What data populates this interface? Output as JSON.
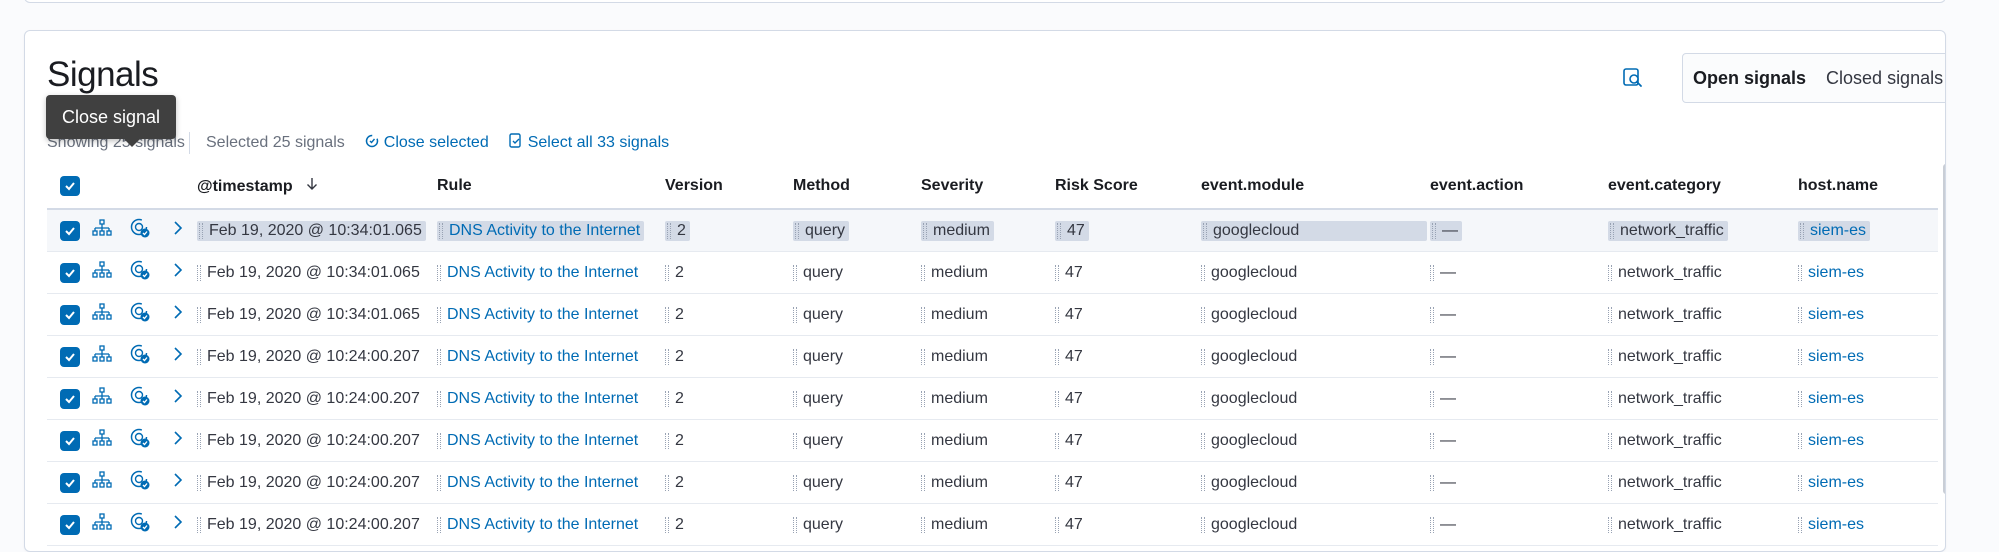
{
  "page": {
    "title": "Signals",
    "toggle": {
      "open_label": "Open signals",
      "closed_label": "Closed signals"
    },
    "inspect_icon": "inspect-icon"
  },
  "utility_bar": {
    "showing_label": "Showing 25 signals",
    "selected_label": "Selected 25 signals",
    "close_selected_label": "Close selected",
    "select_all_label": "Select all 33 signals"
  },
  "tooltip": {
    "text": "Close signal"
  },
  "columns": {
    "timestamp": "@timestamp",
    "rule": "Rule",
    "version": "Version",
    "method": "Method",
    "severity": "Severity",
    "risk_score": "Risk Score",
    "event_module": "event.module",
    "event_action": "event.action",
    "event_category": "event.category",
    "host_name": "host.name"
  },
  "rows": [
    {
      "timestamp": "Feb 19, 2020 @ 10:34:01.065",
      "rule": "DNS Activity to the Internet",
      "version": "2",
      "method": "query",
      "severity": "medium",
      "risk_score": "47",
      "event_module": "googlecloud",
      "event_action": "—",
      "event_category": "network_traffic",
      "host_name": "siem-es"
    },
    {
      "timestamp": "Feb 19, 2020 @ 10:34:01.065",
      "rule": "DNS Activity to the Internet",
      "version": "2",
      "method": "query",
      "severity": "medium",
      "risk_score": "47",
      "event_module": "googlecloud",
      "event_action": "—",
      "event_category": "network_traffic",
      "host_name": "siem-es"
    },
    {
      "timestamp": "Feb 19, 2020 @ 10:34:01.065",
      "rule": "DNS Activity to the Internet",
      "version": "2",
      "method": "query",
      "severity": "medium",
      "risk_score": "47",
      "event_module": "googlecloud",
      "event_action": "—",
      "event_category": "network_traffic",
      "host_name": "siem-es"
    },
    {
      "timestamp": "Feb 19, 2020 @ 10:24:00.207",
      "rule": "DNS Activity to the Internet",
      "version": "2",
      "method": "query",
      "severity": "medium",
      "risk_score": "47",
      "event_module": "googlecloud",
      "event_action": "—",
      "event_category": "network_traffic",
      "host_name": "siem-es"
    },
    {
      "timestamp": "Feb 19, 2020 @ 10:24:00.207",
      "rule": "DNS Activity to the Internet",
      "version": "2",
      "method": "query",
      "severity": "medium",
      "risk_score": "47",
      "event_module": "googlecloud",
      "event_action": "—",
      "event_category": "network_traffic",
      "host_name": "siem-es"
    },
    {
      "timestamp": "Feb 19, 2020 @ 10:24:00.207",
      "rule": "DNS Activity to the Internet",
      "version": "2",
      "method": "query",
      "severity": "medium",
      "risk_score": "47",
      "event_module": "googlecloud",
      "event_action": "—",
      "event_category": "network_traffic",
      "host_name": "siem-es"
    },
    {
      "timestamp": "Feb 19, 2020 @ 10:24:00.207",
      "rule": "DNS Activity to the Internet",
      "version": "2",
      "method": "query",
      "severity": "medium",
      "risk_score": "47",
      "event_module": "googlecloud",
      "event_action": "—",
      "event_category": "network_traffic",
      "host_name": "siem-es"
    },
    {
      "timestamp": "Feb 19, 2020 @ 10:24:00.207",
      "rule": "DNS Activity to the Internet",
      "version": "2",
      "method": "query",
      "severity": "medium",
      "risk_score": "47",
      "event_module": "googlecloud",
      "event_action": "—",
      "event_category": "network_traffic",
      "host_name": "siem-es"
    }
  ],
  "colors": {
    "accent": "#006bb4",
    "tooltip_bg": "#404040",
    "highlight": "#d3dae6"
  }
}
